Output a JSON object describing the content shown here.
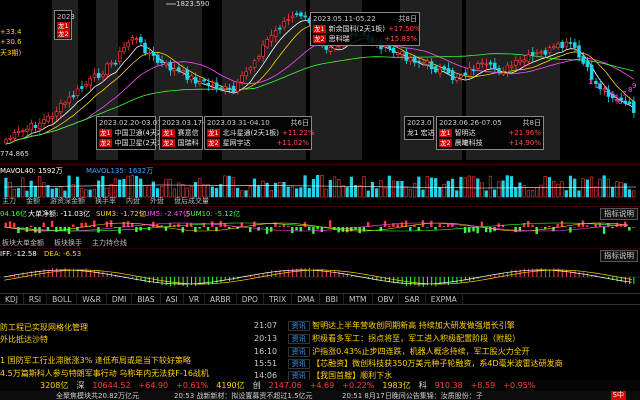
{
  "price_chart": {
    "high_label": "1823.590",
    "low_label": "774.865",
    "tick_labels": [
      "1",
      "2",
      "3",
      "4",
      "5",
      "6",
      "7",
      "8",
      "9"
    ],
    "left_labels": [
      {
        "prefix": "+33.4",
        "color": "#ffd200"
      },
      {
        "prefix": "+30.6",
        "color": "#ffd200"
      },
      {
        "prefix": "天3期)",
        "color": "#ffd200"
      }
    ]
  },
  "annotations": [
    {
      "range": "2023",
      "tag1": "龙1",
      "tag2": "龙2",
      "partial": true
    },
    {
      "range": "2023.02.20-03.07",
      "tag1": "龙1",
      "name1": "中国卫通(4天2板)",
      "tag2": "龙2",
      "name2": "中国卫星(2天1板)"
    },
    {
      "range": "2023.03.17-0",
      "tag1": "龙1",
      "name1": "赛意信",
      "tag2": "龙2",
      "name2": "国瑞科"
    },
    {
      "range": "2023.03.31-04.10",
      "count": "共6日",
      "tag1": "龙1",
      "name1": "北斗星通(2天1板)",
      "pct1": "+11.22%",
      "tag2": "龙2",
      "name2": "星网宇达",
      "pct2": "+11.02%"
    },
    {
      "range": "2023.05.11-05.22",
      "count": "共8日",
      "tag1": "龙1",
      "name1": "新余国科(2天1板)",
      "pct1": "+17.50%",
      "tag2": "龙2",
      "name2": "思科瑞",
      "pct2": "+15.83%"
    },
    {
      "range": "2023.06.26-07.05",
      "count": "共8日",
      "tag1": "龙1",
      "name1": "智明达",
      "pct1": "+21.96%",
      "tag2": "龙2",
      "name2": "晨曦科技",
      "pct2": "+14.90%",
      "prefix": "2023.0",
      "extra": "龙1 宏达"
    }
  ],
  "volume_panel": {
    "label": "MAVOL40: 1592万",
    "label2": "MAVOL135: 1632万",
    "buttons": [
      "主力",
      "金额",
      "游资深金额",
      "换手率",
      "内盘",
      "外盘",
      "盘后成交量"
    ]
  },
  "flow_panel": {
    "label_a": "04.16亿",
    "label_b": "大单净额: -11.03亿",
    "label_c": "SUM3: -1.72亿",
    "label_d": "SUM5: -2.47亿",
    "label_e": "SUM10: -5.12亿",
    "info_button": "指标说明",
    "buttons": [
      "板块大单金额",
      "板块换手",
      "主力持仓线"
    ]
  },
  "macd_panel": {
    "label_a": "IFF: -12.58",
    "label_b": "DEA: -6.53",
    "info_button": "指标说明"
  },
  "indicator_tabs": [
    "KDJ",
    "RSI",
    "BOLL",
    "W&R",
    "DMI",
    "BIAS",
    "ASI",
    "VR",
    "ARBR",
    "DPO",
    "TRIX",
    "DMA",
    "BBI",
    "MTM",
    "OBV",
    "SAR",
    "EXPMA"
  ],
  "left_news": [
    "防工程已实现网格化管理",
    "外比抵达沙特",
    "1 国防军工行业滞胀涨3% 逢低布局或是当下较好策略",
    "4.5万篇斯科人参与特朗军事行动 乌称年内无法获F-16战机"
  ],
  "right_news": [
    {
      "time": "21:07",
      "source": "资讯",
      "text": "智明达上半年营收创同期新高 持续加大研发做强增长引擎"
    },
    {
      "time": "20:13",
      "source": "资讯",
      "text": "积极看多军工：拐点将至，军工进入积极配置阶段（附股）"
    },
    {
      "time": "16:10",
      "source": "资讯",
      "text": "沪指涨0.43%止步四连跌，机器人概念持续，军工股火力全开"
    },
    {
      "time": "15:51",
      "source": "资讯",
      "text": "【芯融资】微创科技获350万美元种子轮融资，系4D毫米波雷达研发商"
    },
    {
      "time": "14:06",
      "source": "资讯",
      "text": "【我国首艘】顺利下水"
    }
  ],
  "ticker": {
    "a": "3208亿",
    "market1": "深",
    "v1": "10644.52",
    "c1": "+64.90",
    "p1": "+0.61%",
    "amt1": "4190亿",
    "market2": "创",
    "v2": "2147.06",
    "c2": "+4.69",
    "p2": "+0.22%",
    "amt2": "1983亿",
    "market3": "科",
    "v3": "910.38",
    "c3": "+8.59",
    "p3": "+0.95%"
  },
  "status_bar": {
    "a": "全聚焦模块共20.82万亿元",
    "b": "20:53 战新新材：拟设置募资不超过1.5亿元",
    "c": "20:51 8月17日晚间公告集锦：汝质股份：子",
    "logo": "S中"
  },
  "colors": {
    "up": "#ff3b3b",
    "down": "#22d3e8",
    "ma5": "#ffffff",
    "ma10": "#ffd200",
    "ma20": "#ff4dff",
    "ma60": "#39ff39"
  }
}
